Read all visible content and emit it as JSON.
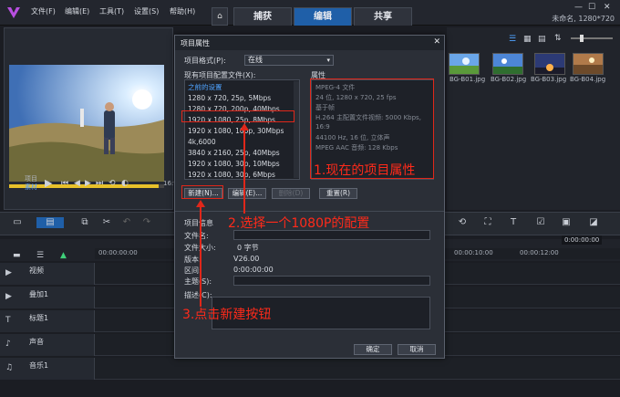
{
  "app": {
    "menu": [
      "文件(F)",
      "编辑(E)",
      "工具(T)",
      "设置(S)",
      "帮助(H)"
    ],
    "tabs": [
      "捕获",
      "编辑",
      "共享"
    ],
    "project_info": "未命名, 1280*720",
    "window_controls": [
      "—",
      "☐",
      "✕"
    ]
  },
  "player": {
    "labels": [
      "项目",
      "素材"
    ],
    "timecode": "16:9"
  },
  "library": {
    "thumbnails": [
      {
        "caption": "BG-B01.jpg",
        "color": "#6aa6e8"
      },
      {
        "caption": "BG-B02.jpg",
        "color": "#4d86d6"
      },
      {
        "caption": "BG-B03.jpg",
        "color": "#2c3a75"
      },
      {
        "caption": "BG-B04.jpg",
        "color": "#b07a4a"
      }
    ]
  },
  "timeline": {
    "ruler": [
      "00:00:00:00",
      "00:00:10:00",
      "00:00:12:00"
    ],
    "timecode": "0:00:00:00",
    "tracks": [
      "视频",
      "叠加1",
      "标题1",
      "声音",
      "音乐1"
    ]
  },
  "dialog": {
    "title": "项目属性",
    "close": "✕",
    "format_label": "项目格式(P):",
    "format_value": "在线",
    "profiles_label": "现有项目配置文件(X):",
    "attributes_label": "属性",
    "profiles": [
      "之前的设置",
      "1280 x 720, 25p, 5Mbps",
      "1280 x 720, 200p, 40Mbps",
      "1920 x 1080, 25p, 8Mbps",
      "1920 x 1080, 100p, 30Mbps",
      "4k,6000",
      "3840 x 2160, 25p, 40Mbps",
      "1920 x 1080, 30p, 10Mbps",
      "1920 x 1080, 30p, 6Mbps"
    ],
    "attributes": [
      "MPEG-4 文件",
      "24 位, 1280 x 720, 25 fps",
      "基于帧",
      "H.264 主配置文件视频: 5000 Kbps,",
      "16:9",
      "44100 Hz, 16 位, 立体声",
      "MPEG AAC 音频: 128 Kbps"
    ],
    "buttons": [
      "新建(N)...",
      "编辑(E)...",
      "删除(D)",
      "重置(R)"
    ],
    "info_label": "项目信息",
    "info_fields": [
      {
        "label": "文件名:",
        "value": ""
      },
      {
        "label": "文件大小:",
        "value": "0 字节"
      },
      {
        "label": "版本:",
        "value": "V26.00"
      },
      {
        "label": "区间:",
        "value": "0:00:00:00"
      },
      {
        "label": "主题(S):",
        "value": ""
      }
    ],
    "desc_label": "描述(C):",
    "ok": "确定",
    "cancel": "取消"
  },
  "annotations": {
    "a1": "1.现在的项目属性",
    "a2": "2.选择一个1080P的配置",
    "a3": "3.点击新建按钮",
    "color": "#ff2a1a"
  }
}
